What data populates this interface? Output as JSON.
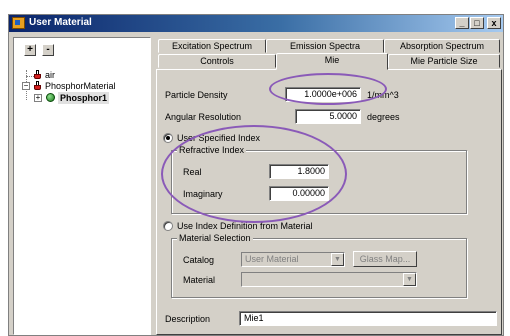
{
  "window": {
    "title": "User Material"
  },
  "titlebar_buttons": {
    "minimize": "_",
    "maximize": "□",
    "close": "x"
  },
  "tree": {
    "expand_all": "+",
    "collapse_all": "-",
    "items": [
      {
        "label": "air"
      },
      {
        "label": "PhosphorMaterial"
      },
      {
        "label": "Phosphor1"
      }
    ]
  },
  "tabs": {
    "row1": [
      "Excitation Spectrum",
      "Emission Spectra",
      "Absorption Spectrum"
    ],
    "row2": [
      "Controls",
      "Mie",
      "Mie Particle Size"
    ]
  },
  "mie": {
    "particle_density_label": "Particle Density",
    "particle_density_value": "1.0000e+006",
    "particle_density_unit": "1/mm^3",
    "angular_resolution_label": "Angular Resolution",
    "angular_resolution_value": "5.0000",
    "angular_resolution_unit": "degrees",
    "user_index_label": "User Specified Index",
    "refractive_index_group": "Refractive Index",
    "real_label": "Real",
    "real_value": "1.8000",
    "imaginary_label": "Imaginary",
    "imaginary_value": "0.00000",
    "use_index_def_label": "Use Index Definition from Material",
    "material_selection_group": "Material Selection",
    "catalog_label": "Catalog",
    "catalog_value": "User Material",
    "glass_map_button": "Glass Map...",
    "material_label": "Material",
    "material_value": "",
    "description_label": "Description",
    "description_value": "Mie1"
  },
  "colors": {
    "annotation": "#8a5ab8",
    "titlebar": "#0a246a",
    "window_bg": "#d4d0c8"
  }
}
